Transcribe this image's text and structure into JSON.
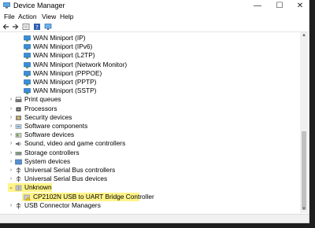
{
  "window": {
    "title": "Device Manager"
  },
  "controls": {
    "minimize": "—",
    "maximize": "☐",
    "close": "✕"
  },
  "menu": [
    "File",
    "Action",
    "View",
    "Help"
  ],
  "toolbar_icons": [
    "back-arrow-icon",
    "forward-arrow-icon",
    "properties-icon",
    "help-icon",
    "monitor-icon"
  ],
  "tree": [
    {
      "label": "WAN Miniport (IP)",
      "icon": "network-adapter-icon",
      "level": 2
    },
    {
      "label": "WAN Miniport (IPv6)",
      "icon": "network-adapter-icon",
      "level": 2
    },
    {
      "label": "WAN Miniport (L2TP)",
      "icon": "network-adapter-icon",
      "level": 2
    },
    {
      "label": "WAN Miniport (Network Monitor)",
      "icon": "network-adapter-icon",
      "level": 2
    },
    {
      "label": "WAN Miniport (PPPOE)",
      "icon": "network-adapter-icon",
      "level": 2
    },
    {
      "label": "WAN Miniport (PPTP)",
      "icon": "network-adapter-icon",
      "level": 2
    },
    {
      "label": "WAN Miniport (SSTP)",
      "icon": "network-adapter-icon",
      "level": 2
    },
    {
      "label": "Print queues",
      "icon": "printer-icon",
      "level": 1,
      "expander": "›"
    },
    {
      "label": "Processors",
      "icon": "processor-icon",
      "level": 1,
      "expander": "›"
    },
    {
      "label": "Security devices",
      "icon": "security-device-icon",
      "level": 1,
      "expander": "›"
    },
    {
      "label": "Software components",
      "icon": "software-component-icon",
      "level": 1,
      "expander": "›"
    },
    {
      "label": "Software devices",
      "icon": "software-device-icon",
      "level": 1,
      "expander": "›"
    },
    {
      "label": "Sound, video and game controllers",
      "icon": "speaker-icon",
      "level": 1,
      "expander": "›"
    },
    {
      "label": "Storage controllers",
      "icon": "storage-controller-icon",
      "level": 1,
      "expander": "›"
    },
    {
      "label": "System devices",
      "icon": "system-device-icon",
      "level": 1,
      "expander": "›"
    },
    {
      "label": "Universal Serial Bus controllers",
      "icon": "usb-controller-icon",
      "level": 1,
      "expander": "›"
    },
    {
      "label": "Universal Serial Bus devices",
      "icon": "usb-device-icon",
      "level": 1,
      "expander": "›"
    },
    {
      "label": "Unknown",
      "icon": "unknown-device-icon",
      "level": 1,
      "expander": "⌄",
      "highlight": true
    },
    {
      "label": "CP2102N USB to UART Bridge Controller",
      "icon": "warning-device-icon",
      "level": 2,
      "highlight": true
    },
    {
      "label": "USB Connector Managers",
      "icon": "usb-connector-icon",
      "level": 1,
      "expander": "›"
    }
  ],
  "colors": {
    "highlight": "#fff48a",
    "folder": "#e8b34a",
    "network": "#3a8fd8"
  }
}
